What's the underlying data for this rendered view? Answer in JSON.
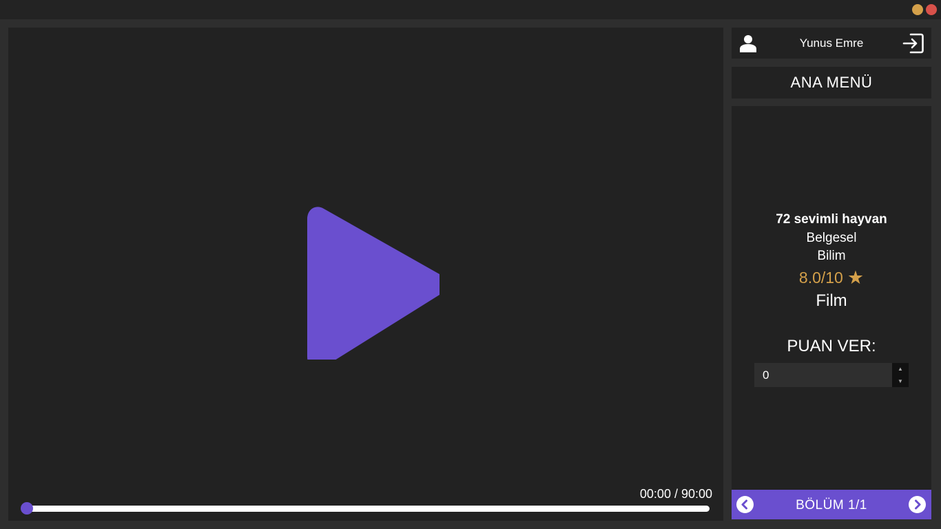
{
  "window": {
    "controls": [
      "minimize",
      "close"
    ],
    "colors": {
      "minimize": "#d4a04a",
      "close": "#d8514a"
    }
  },
  "player": {
    "time_display": "00:00 / 90:00",
    "progress": 0,
    "accent": "#6a4fcf",
    "icons": {
      "play": "play-icon"
    }
  },
  "user": {
    "name": "Yunus Emre",
    "icons": {
      "avatar": "user-icon",
      "logout": "logout-icon"
    }
  },
  "main_menu": {
    "label": "ANA MENÜ"
  },
  "movie": {
    "title": "72 sevimli hayvan",
    "genres": [
      "Belgesel",
      "Bilim"
    ],
    "rating": "8.0/10",
    "rating_icon": "star-icon",
    "rating_color": "#d4a04a",
    "type": "Film"
  },
  "rate": {
    "label": "PUAN VER:",
    "value": "0"
  },
  "episode": {
    "label": "BÖLÜM 1/1",
    "icons": {
      "prev": "chevron-left-icon",
      "next": "chevron-right-icon"
    }
  }
}
